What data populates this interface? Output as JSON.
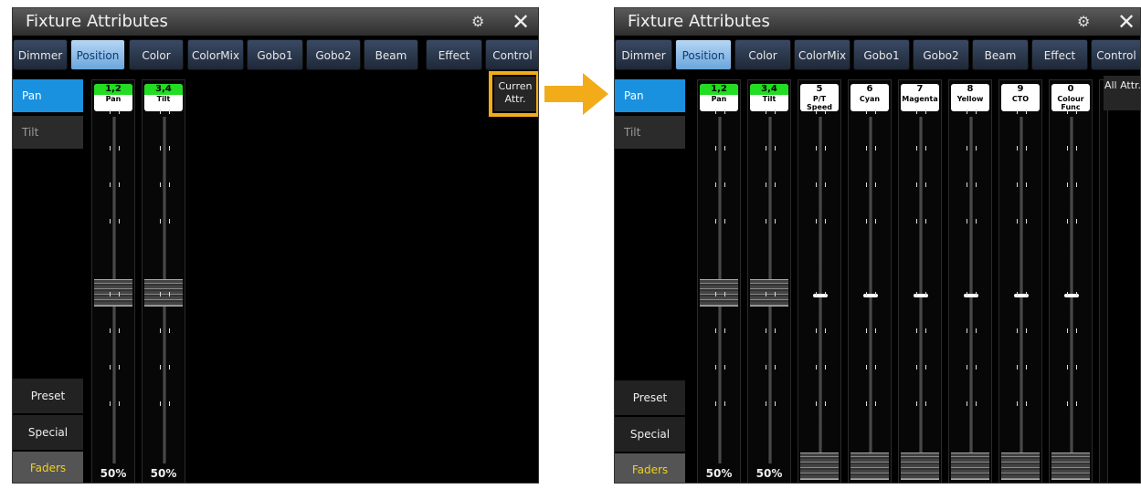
{
  "left": {
    "title": "Fixture Attributes",
    "tabs": [
      "Dimmer",
      "Position",
      "Color",
      "ColorMix",
      "Gobo1",
      "Gobo2",
      "Beam",
      "Effect",
      "Control"
    ],
    "active_tab": "Position",
    "side_top": [
      "Pan",
      "Tilt"
    ],
    "side_bottom": [
      "Preset",
      "Special",
      "Faders"
    ],
    "faders": [
      {
        "num": "1,2",
        "name": "Pan",
        "value": "50%"
      },
      {
        "num": "3,4",
        "name": "Tilt",
        "value": "50%"
      }
    ],
    "current_attr_label": "Curren Attr."
  },
  "right": {
    "title": "Fixture Attributes",
    "tabs": [
      "Dimmer",
      "Position",
      "Color",
      "ColorMix",
      "Gobo1",
      "Gobo2",
      "Beam",
      "Effect",
      "Control"
    ],
    "active_tab": "Position",
    "side_top": [
      "Pan",
      "Tilt"
    ],
    "side_bottom": [
      "Preset",
      "Special",
      "Faders"
    ],
    "faders": [
      {
        "num": "1,2",
        "name": "Pan",
        "value": "50%"
      },
      {
        "num": "3,4",
        "name": "Tilt",
        "value": "50%"
      },
      {
        "num": "5",
        "name": "P/T Speed",
        "value": ""
      },
      {
        "num": "6",
        "name": "Cyan",
        "value": ""
      },
      {
        "num": "7",
        "name": "Magenta",
        "value": ""
      },
      {
        "num": "8",
        "name": "Yellow",
        "value": ""
      },
      {
        "num": "9",
        "name": "CTO",
        "value": ""
      },
      {
        "num": "0",
        "name": "Colour Func",
        "value": ""
      }
    ],
    "all_attr_label": "All Attr."
  },
  "colors": {
    "highlight": "#f2ac1a",
    "active_side": "#1991df",
    "green_badge": "#22dd22"
  }
}
